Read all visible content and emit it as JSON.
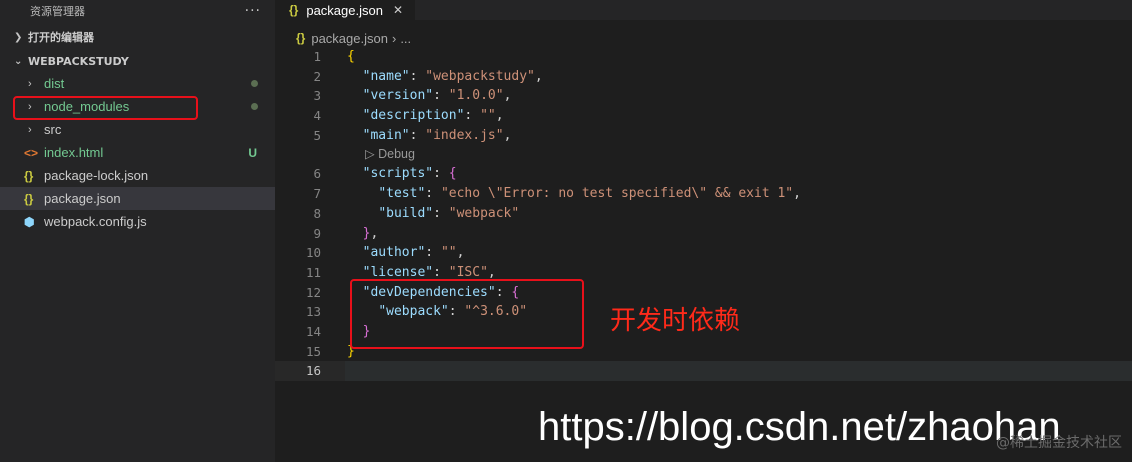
{
  "explorer": {
    "title": "资源管理器",
    "more": "···",
    "open_editors": "打开的编辑器",
    "project": "WEBPACKSTUDY",
    "items": [
      {
        "label": "dist",
        "type": "folder",
        "color": "#73c991",
        "badge": "dot"
      },
      {
        "label": "node_modules",
        "type": "folder",
        "color": "#73c991",
        "badge": "dot"
      },
      {
        "label": "src",
        "type": "folder",
        "color": "#cccccc",
        "badge": ""
      },
      {
        "label": "index.html",
        "type": "html",
        "color": "#73c991",
        "badge": "U"
      },
      {
        "label": "package-lock.json",
        "type": "json",
        "color": "#cccccc",
        "badge": ""
      },
      {
        "label": "package.json",
        "type": "json",
        "color": "#cccccc",
        "badge": ""
      },
      {
        "label": "webpack.config.js",
        "type": "webpack",
        "color": "#cccccc",
        "badge": ""
      }
    ]
  },
  "tab": {
    "label": "package.json",
    "icon": "{}",
    "close": "✕"
  },
  "breadcrumb": {
    "file": "package.json",
    "sep": "›",
    "more": "..."
  },
  "code_lens": "Debug",
  "annotation": "开发时依赖",
  "watermark_url": "https://blog.csdn.net/zhaohan",
  "watermark_site": "@稀土掘金技术社区",
  "colors": {
    "key": "#9cdcfe",
    "string": "#ce9178",
    "punct": "#d4d4d4",
    "annot_red": "#e8101a"
  }
}
